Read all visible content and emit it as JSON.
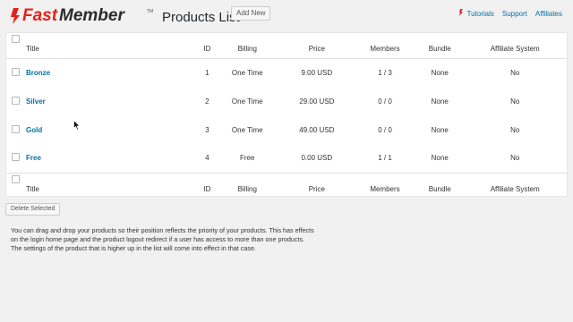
{
  "header": {
    "logo_text": "FastMember",
    "page_title": "Products List",
    "add_new_label": "Add New",
    "links": [
      {
        "label": "Tutorials"
      },
      {
        "label": "Support"
      },
      {
        "label": "Affiliates"
      }
    ],
    "accent_color": "#e2231a"
  },
  "table": {
    "columns": [
      "Title",
      "ID",
      "Billing",
      "Price",
      "Members",
      "Bundle",
      "Affiliate System"
    ],
    "rows": [
      {
        "title": "Bronze",
        "id": "1",
        "billing": "One Time",
        "price": "9.00 USD",
        "members": "1 / 3",
        "bundle": "None",
        "affiliate": "No"
      },
      {
        "title": "Silver",
        "id": "2",
        "billing": "One Time",
        "price": "29.00 USD",
        "members": "0 / 0",
        "bundle": "None",
        "affiliate": "No"
      },
      {
        "title": "Gold",
        "id": "3",
        "billing": "One Time",
        "price": "49.00 USD",
        "members": "0 / 0",
        "bundle": "None",
        "affiliate": "No"
      },
      {
        "title": "Free",
        "id": "4",
        "billing": "Free",
        "price": "0.00 USD",
        "members": "1 / 1",
        "bundle": "None",
        "affiliate": "No"
      }
    ]
  },
  "actions": {
    "delete_selected_label": "Delete Selected"
  },
  "help": {
    "text": "You can drag and drop your products so their position reflects the priority of your products. This has effects on the login home page and the product logout redirect if a user has access to more than one products. The settings of the product that is higher up in the list will come into effect in that case."
  }
}
